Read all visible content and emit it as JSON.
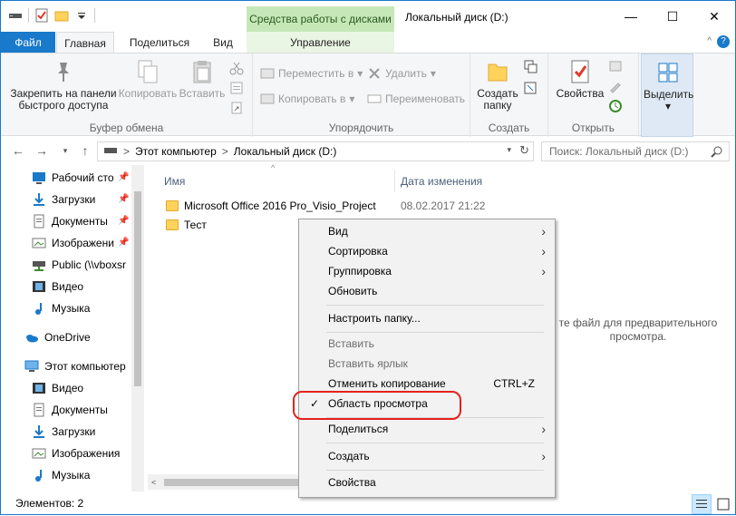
{
  "window": {
    "title": "Локальный диск (D:)",
    "context_tab_title": "Средства работы с дисками",
    "minimize_glyph": "—",
    "maximize_glyph": "☐",
    "close_glyph": "✕"
  },
  "tabs": {
    "file": "Файл",
    "home": "Главная",
    "share": "Поделиться",
    "view": "Вид",
    "manage": "Управление"
  },
  "ribbon": {
    "clipboard": {
      "label": "Буфер обмена",
      "pin": "Закрепить на панели быстрого доступа",
      "copy": "Копировать",
      "paste": "Вставить"
    },
    "organize": {
      "label": "Упорядочить",
      "move_to": "Переместить в",
      "copy_to": "Копировать в",
      "delete": "Удалить",
      "rename": "Переименовать"
    },
    "new": {
      "label": "Создать",
      "new_folder": "Создать папку"
    },
    "open": {
      "label": "Открыть",
      "properties": "Свойства"
    },
    "select": {
      "select": "Выделить"
    }
  },
  "address": {
    "segments": [
      "Этот компьютер",
      "Локальный диск (D:)"
    ],
    "separator": ">",
    "search_placeholder": "Поиск: Локальный диск (D:)"
  },
  "nav": {
    "quick": [
      {
        "label": "Рабочий сто",
        "icon": "desktop-icon"
      },
      {
        "label": "Загрузки",
        "icon": "downloads-icon"
      },
      {
        "label": "Документы",
        "icon": "documents-icon"
      },
      {
        "label": "Изображени",
        "icon": "pictures-icon"
      },
      {
        "label": "Public (\\\\vboxsr",
        "icon": "network-drive-icon"
      },
      {
        "label": "Видео",
        "icon": "videos-icon"
      },
      {
        "label": "Музыка",
        "icon": "music-icon"
      }
    ],
    "onedrive": "OneDrive",
    "this_pc": "Этот компьютер",
    "pc_items": [
      {
        "label": "Видео",
        "icon": "videos-icon"
      },
      {
        "label": "Документы",
        "icon": "documents-icon"
      },
      {
        "label": "Загрузки",
        "icon": "downloads-icon"
      },
      {
        "label": "Изображения",
        "icon": "pictures-icon"
      },
      {
        "label": "Музыка",
        "icon": "music-icon"
      }
    ]
  },
  "content": {
    "columns": {
      "name": "Имя",
      "date": "Дата изменения"
    },
    "files": [
      {
        "name": "Microsoft Office 2016 Pro_Visio_Project",
        "date": "08.02.2017 21:22"
      },
      {
        "name": "Тест",
        "date": ""
      }
    ],
    "preview_message": "те файл для предварительного просмотра."
  },
  "status": {
    "items": "Элементов: 2"
  },
  "context_menu": {
    "view": "Вид",
    "sort": "Сортировка",
    "group": "Группировка",
    "refresh": "Обновить",
    "customize": "Настроить папку...",
    "paste": "Вставить",
    "paste_shortcut": "Вставить ярлык",
    "undo_copy": "Отменить копирование",
    "undo_copy_key": "CTRL+Z",
    "preview_pane": "Область просмотра",
    "share": "Поделиться",
    "new": "Создать",
    "properties": "Свойства",
    "check_glyph": "✓",
    "submenu_glyph": "›"
  },
  "colors": {
    "accent": "#1979ca",
    "manage_tab": "#c6e8b9",
    "highlight_ring": "#e3211c",
    "folder": "#ffd35b"
  }
}
